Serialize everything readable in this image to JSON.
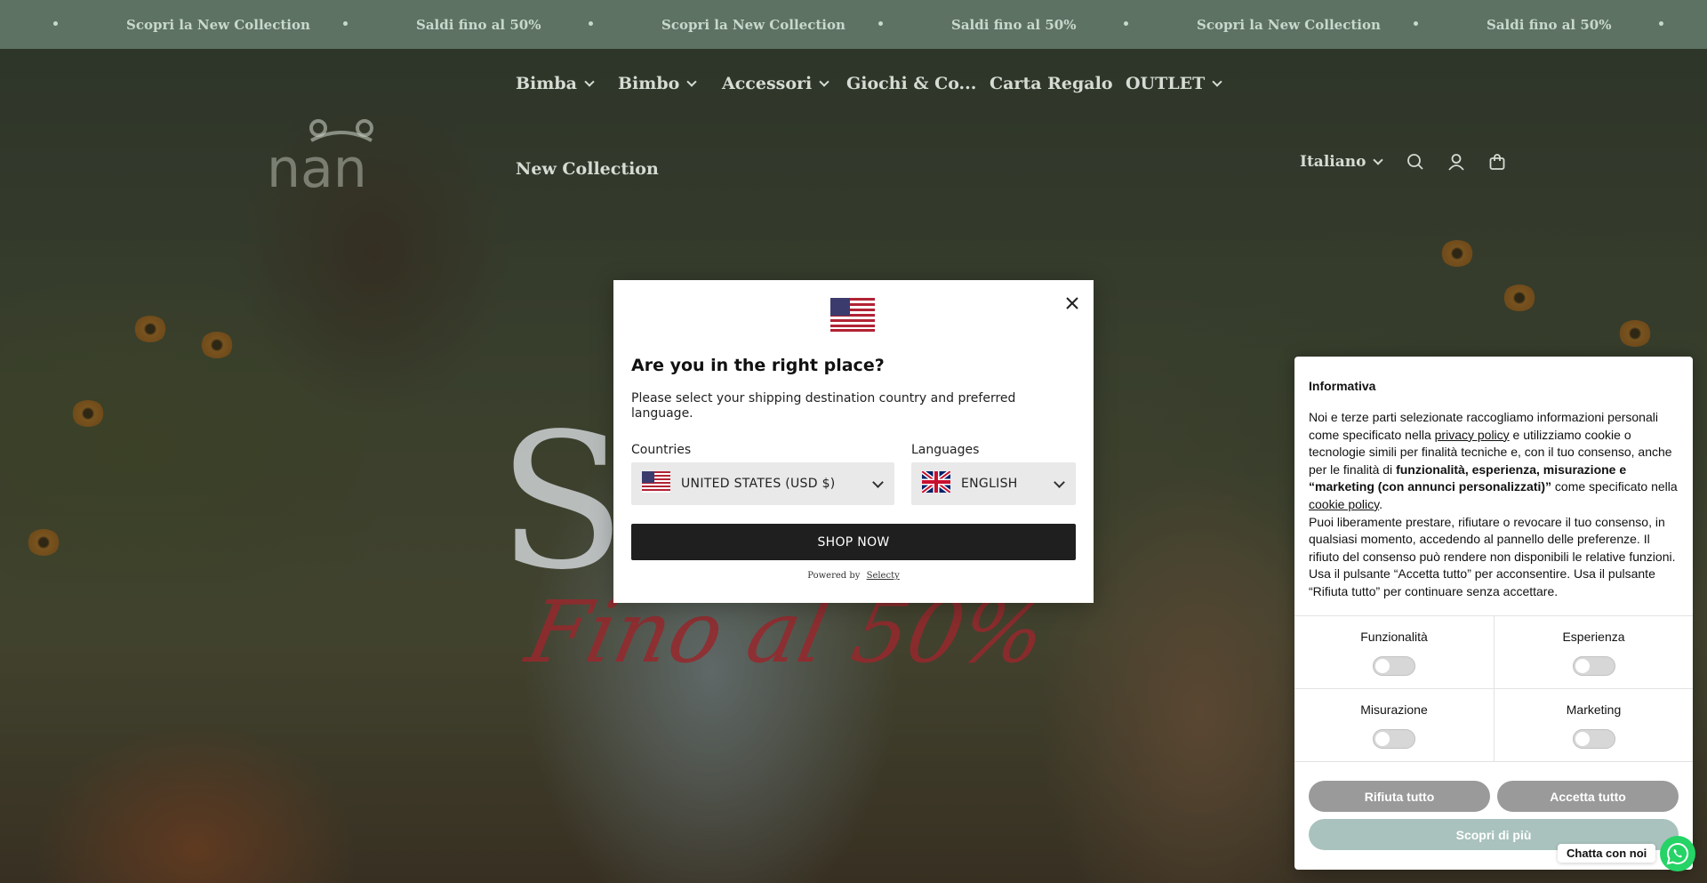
{
  "announcement": {
    "items": [
      "Scopri la New Collection",
      "Saldi fino al 50%",
      "Scopri la New Collection",
      "Saldi fino al 50%",
      "Scopri la New Collection",
      "Saldi fino al 50%"
    ]
  },
  "header": {
    "logo_text": "nan",
    "nav": [
      {
        "label": "Bimba",
        "dropdown": true
      },
      {
        "label": "Bimbo",
        "dropdown": true
      },
      {
        "label": "Accessori",
        "dropdown": true
      },
      {
        "label": "Giochi & Co...",
        "dropdown": false
      },
      {
        "label": "Carta Regalo",
        "dropdown": false
      },
      {
        "label": "OUTLET",
        "dropdown": true
      },
      {
        "label": "New Collection",
        "dropdown": false
      }
    ],
    "language": "Italiano",
    "icons": [
      "search-icon",
      "account-icon",
      "cart-icon"
    ]
  },
  "hero": {
    "big_letter": "S",
    "script_text": "Fino al 50%"
  },
  "modal": {
    "title": "Are you in the right place?",
    "description": "Please select your shipping destination country and preferred language.",
    "countries_label": "Countries",
    "country_value": "UNITED STATES (USD $)",
    "languages_label": "Languages",
    "language_value": "ENGLISH",
    "shop_button": "SHOP NOW",
    "powered_by": "Powered by",
    "powered_link": "Selecty"
  },
  "cookie": {
    "title": "Informativa",
    "body_1": "Noi e terze parti selezionate raccogliamo informazioni personali come specificato nella ",
    "privacy_link": "privacy policy",
    "body_2": " e utilizziamo cookie o tecnologie simili per finalità tecniche e, con il tuo consenso, anche per le finalità di ",
    "body_bold": "funzionalità, esperienza, misurazione e “marketing (con annunci personalizzati)”",
    "body_3": " come specificato nella ",
    "cookie_link": "cookie policy",
    "body_4": ".",
    "body_5": "Puoi liberamente prestare, rifiutare o revocare il tuo consenso, in qualsiasi momento, accedendo al pannello delle preferenze. Il rifiuto del consenso può rendere non disponibili le relative funzioni. Usa il pulsante “Accetta tutto” per acconsentire. Usa il pulsante “Rifiuta tutto” per continuare senza accettare.",
    "toggles": [
      "Funzionalità",
      "Esperienza",
      "Misurazione",
      "Marketing"
    ],
    "reject_button": "Rifiuta tutto",
    "accept_button": "Accetta tutto",
    "more_button": "Scopri di più",
    "colors": {
      "reject": "#9a9a9a",
      "accept": "#9a9a9a",
      "more": "#a9c2bd"
    }
  },
  "chat": {
    "label": "Chatta con noi"
  }
}
